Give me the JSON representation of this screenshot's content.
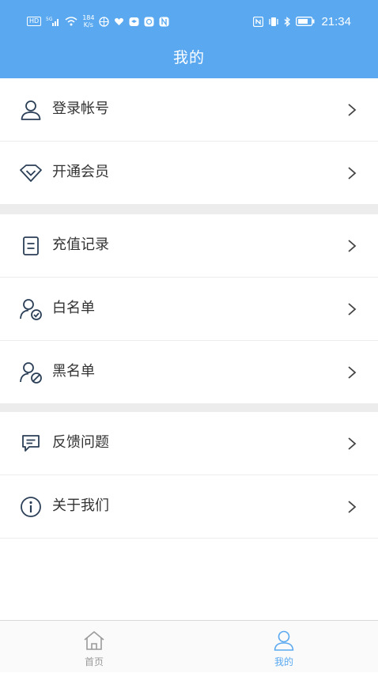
{
  "status_bar": {
    "left_chips": [
      "HD",
      "5G"
    ],
    "speed_value": "184",
    "speed_unit": "K/s",
    "time": "21:34"
  },
  "header": {
    "title": "我的"
  },
  "menu": {
    "items": [
      {
        "label": "登录帐号",
        "icon": "user-icon"
      },
      {
        "label": "开通会员",
        "icon": "diamond-icon"
      },
      {
        "label": "充值记录",
        "icon": "document-icon"
      },
      {
        "label": "白名单",
        "icon": "user-check-icon"
      },
      {
        "label": "黑名单",
        "icon": "user-block-icon"
      },
      {
        "label": "反馈问题",
        "icon": "message-icon"
      },
      {
        "label": "关于我们",
        "icon": "info-icon"
      }
    ]
  },
  "tabbar": {
    "tabs": [
      {
        "label": "首页",
        "icon": "home-icon",
        "active": false
      },
      {
        "label": "我的",
        "icon": "profile-icon",
        "active": true
      }
    ]
  },
  "colors": {
    "header_bg": "#5aa9f0",
    "icon_stroke": "#2b3f57",
    "active_tab": "#5aa9f0",
    "inactive_tab": "#9a9a9a"
  }
}
